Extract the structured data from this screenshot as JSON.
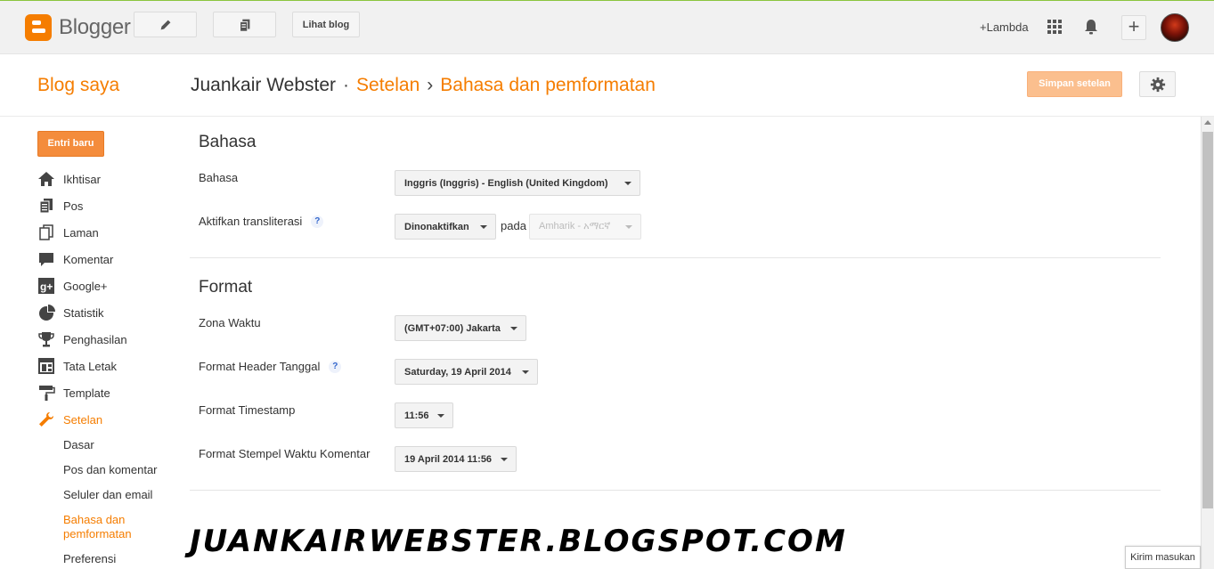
{
  "topbar": {
    "logo_text": "Blogger",
    "view_blog": "Lihat blog",
    "user": "+Lambda"
  },
  "header": {
    "blog_saya": "Blog saya",
    "blog_name": "Juankair Webster",
    "sep1": "·",
    "crumb_setelan": "Setelan",
    "sep2": "›",
    "crumb_page": "Bahasa dan pemformatan",
    "save_label": "Simpan setelan"
  },
  "sidebar": {
    "new_post": "Entri baru",
    "items": [
      {
        "label": "Ikhtisar",
        "icon": "home-icon"
      },
      {
        "label": "Pos",
        "icon": "posts-icon"
      },
      {
        "label": "Laman",
        "icon": "pages-icon"
      },
      {
        "label": "Komentar",
        "icon": "comment-icon"
      },
      {
        "label": "Google+",
        "icon": "google-plus-icon"
      },
      {
        "label": "Statistik",
        "icon": "pie-chart-icon"
      },
      {
        "label": "Penghasilan",
        "icon": "trophy-icon"
      },
      {
        "label": "Tata Letak",
        "icon": "layout-icon"
      },
      {
        "label": "Template",
        "icon": "paint-roller-icon"
      },
      {
        "label": "Setelan",
        "icon": "wrench-icon"
      }
    ],
    "sub_items": [
      "Dasar",
      "Pos dan komentar",
      "Seluler dan email",
      "Bahasa dan pemformatan",
      "Preferensi"
    ]
  },
  "bahasa": {
    "title": "Bahasa",
    "lang_label": "Bahasa",
    "lang_value": "Inggris (Inggris) - English (United Kingdom)",
    "translit_label": "Aktifkan transliterasi",
    "help": "?",
    "translit_value": "Dinonaktifkan",
    "pada": "pada",
    "translit_lang": "Amharik - አማርኛ"
  },
  "format": {
    "title": "Format",
    "tz_label": "Zona Waktu",
    "tz_value": "(GMT+07:00) Jakarta",
    "date_header_label": "Format Header Tanggal",
    "date_header_value": "Saturday, 19 April 2014",
    "timestamp_label": "Format Timestamp",
    "timestamp_value": "11:56",
    "comment_ts_label": "Format Stempel Waktu Komentar",
    "comment_ts_value": "19 April 2014 11:56"
  },
  "watermark": "JUANKAIRWEBSTER.BLOGSPOT.COM",
  "feedback": "Kirim masukan",
  "colors": {
    "accent": "#f57d00",
    "save_disabled": "#fbbf8e",
    "new_post": "#f48c3c"
  }
}
